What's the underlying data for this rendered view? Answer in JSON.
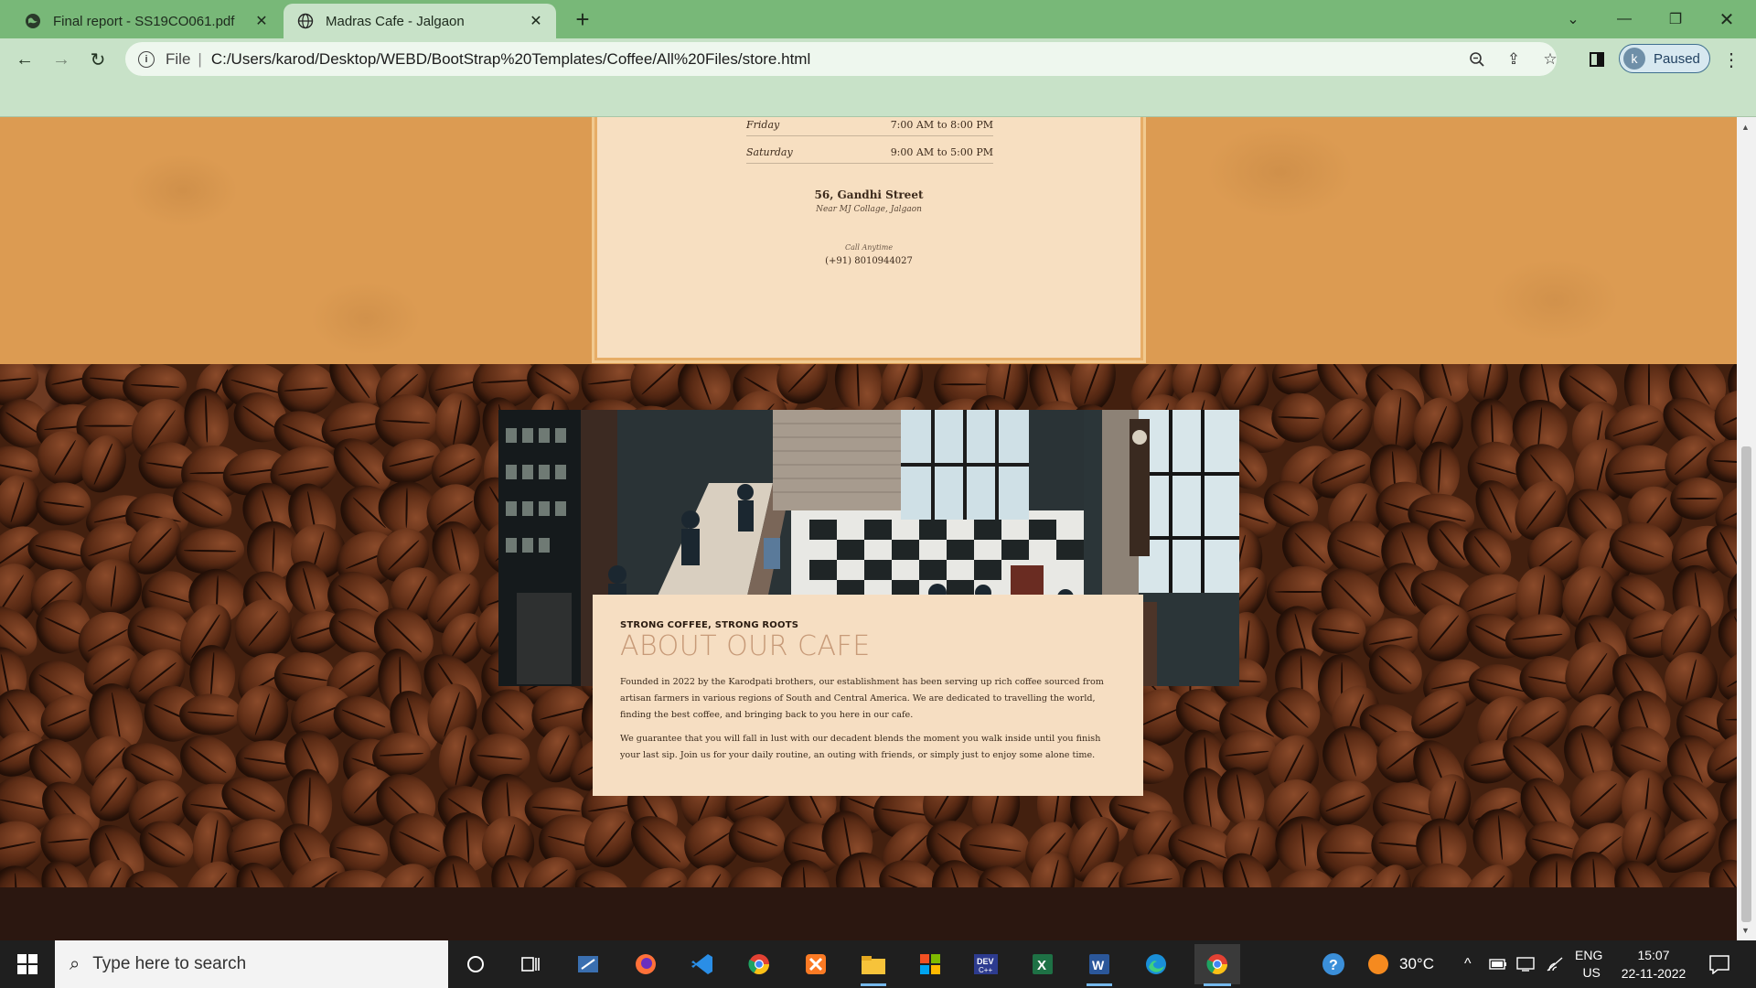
{
  "browser": {
    "tabs": [
      {
        "title": "Final report - SS19CO061.pdf",
        "icon": "globe-icon",
        "active": false
      },
      {
        "title": "Madras Cafe - Jalgaon",
        "icon": "globe-icon",
        "active": true
      }
    ],
    "new_tab": "+",
    "address": {
      "scheme": "File",
      "url": "C:/Users/karod/Desktop/WEBD/BootStrap%20Templates/Coffee/All%20Files/store.html"
    },
    "profile": {
      "initial": "k",
      "status": "Paused"
    },
    "colors": {
      "frame": "#78b878",
      "toolbar": "#c8e2c8"
    }
  },
  "store": {
    "hours": [
      {
        "day": "Friday",
        "time": "7:00 AM to 8:00 PM"
      },
      {
        "day": "Saturday",
        "time": "9:00 AM to 5:00 PM"
      }
    ],
    "address_street": "56, Gandhi Street",
    "address_near": "Near MJ Collage, Jalgaon",
    "call_label": "Call Anytime",
    "phone": "(+91) 8010944027"
  },
  "about": {
    "subheading": "STRONG COFFEE, STRONG ROOTS",
    "heading": "ABOUT OUR CAFE",
    "paragraph1": "Founded in 2022 by the Karodpati brothers, our establishment has been serving up rich coffee sourced from artisan farmers in various regions of South and Central America. We are dedicated to travelling the world, finding the best coffee, and bringing back to you here in our cafe.",
    "paragraph2": "We guarantee that you will fall in lust with our decadent blends the moment you walk inside until you finish your last sip. Join us for your daily routine, an outing with friends, or simply just to enjoy some alone time."
  },
  "taskbar": {
    "search_placeholder": "Type here to search",
    "weather": "30°C",
    "lang_top": "ENG",
    "lang_bottom": "US",
    "time": "15:07",
    "date": "22-11-2022"
  },
  "page_colors": {
    "orange_bg": "#dc9b52",
    "card_bg": "#f7dfc1",
    "beans_bg": "#43200f"
  }
}
